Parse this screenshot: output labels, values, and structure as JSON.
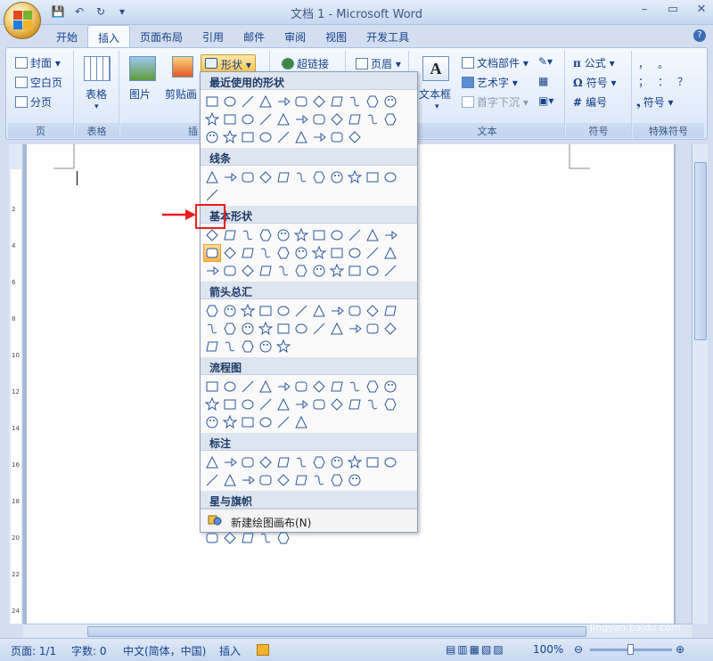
{
  "window": {
    "title": "文档 1 - Microsoft Word",
    "controls": [
      "–",
      "▭",
      "✕"
    ]
  },
  "tabs": [
    {
      "label": "开始",
      "active": false
    },
    {
      "label": "插入",
      "active": true
    },
    {
      "label": "页面布局",
      "active": false
    },
    {
      "label": "引用",
      "active": false
    },
    {
      "label": "邮件",
      "active": false
    },
    {
      "label": "审阅",
      "active": false
    },
    {
      "label": "视图",
      "active": false
    },
    {
      "label": "开发工具",
      "active": false
    }
  ],
  "ribbon": {
    "pages_group": {
      "label": "页",
      "items": [
        "封面",
        "空白页",
        "分页"
      ]
    },
    "table_group": {
      "label": "表格",
      "button": "表格"
    },
    "illustrations_group": {
      "label": "插",
      "picture": "图片",
      "clipart": "剪贴画",
      "shapes": "形状"
    },
    "links_group": {
      "hyperlink": "超链接"
    },
    "header_group": {
      "header": "页眉"
    },
    "text_group": {
      "label": "文本",
      "textbox": "文本框",
      "parts": "文档部件",
      "wordart": "艺术字",
      "dropcap": "首字下沉"
    },
    "symbols_group": {
      "label": "符号",
      "formula": "公式",
      "symbol": "符号",
      "number": "编号"
    },
    "special_group": {
      "label": "特殊符号",
      "symbol": "符号",
      "chars": [
        "，",
        "。",
        "；",
        "：",
        "？"
      ]
    }
  },
  "gallery": {
    "sections": [
      {
        "title": "最近使用的形状",
        "count": 31
      },
      {
        "title": "线条",
        "count": 12
      },
      {
        "title": "基本形状",
        "count": 33,
        "selected_index": 11
      },
      {
        "title": "箭头总汇",
        "count": 27
      },
      {
        "title": "流程图",
        "count": 28
      },
      {
        "title": "标注",
        "count": 20
      },
      {
        "title": "星与旗帜",
        "count": 16
      }
    ],
    "footer": "新建绘图画布(N)"
  },
  "status": {
    "page": "页面: 1/1",
    "words": "字数: 0",
    "language": "中文(简体，中国)",
    "mode": "插入",
    "zoom": "100%"
  },
  "watermark": {
    "text": "Bai 经验",
    "sub": "jingyan.baidu.com"
  }
}
